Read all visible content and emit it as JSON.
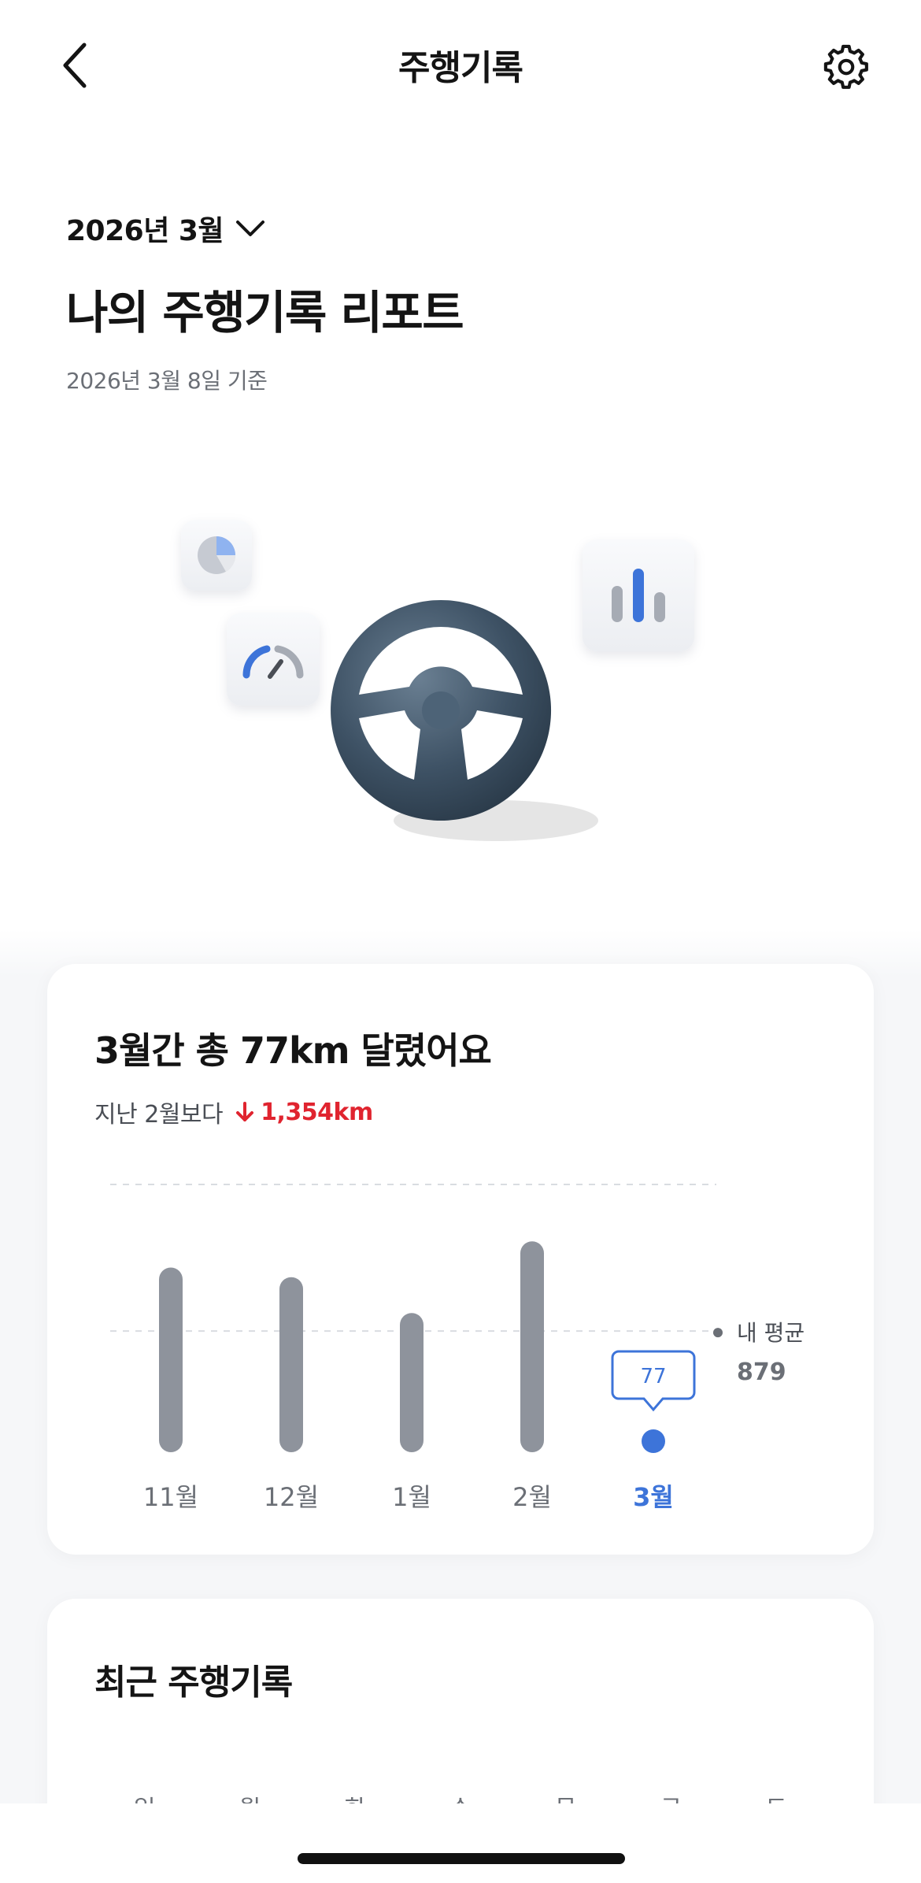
{
  "header": {
    "title": "주행기록",
    "back_icon": "chevron-left-icon",
    "settings_icon": "gear-icon"
  },
  "report": {
    "month_label": "2026년 3월",
    "title": "나의 주행기록 리포트",
    "basis_date": "2026년 3월 8일 기준"
  },
  "summary": {
    "title": "3월간 총 77km 달렸어요",
    "compare_prefix": "지난 2월보다",
    "compare_delta": "1,354km",
    "delta_color": "#e0242f"
  },
  "chart_data": {
    "type": "bar",
    "categories": [
      "11월",
      "12월",
      "1월",
      "2월",
      "3월"
    ],
    "values": [
      1340,
      1270,
      1010,
      1530,
      77
    ],
    "current_index": 4,
    "current_label": "77",
    "average": {
      "label": "내 평균",
      "value": 879,
      "value_label": "879"
    },
    "bar_color": "#8e939c",
    "current_color": "#3d74d9",
    "grid": true
  },
  "recent": {
    "title": "최근 주행기록",
    "weekdays": [
      "일",
      "월",
      "화",
      "수",
      "목",
      "금",
      "토"
    ]
  }
}
